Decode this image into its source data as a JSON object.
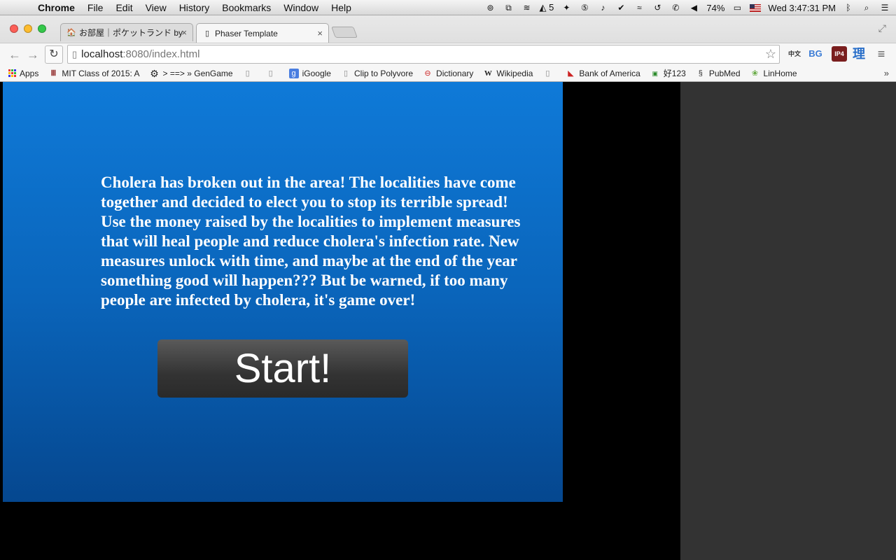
{
  "menubar": {
    "app_name": "Chrome",
    "items": [
      "File",
      "Edit",
      "View",
      "History",
      "Bookmarks",
      "Window",
      "Help"
    ],
    "status": {
      "adobe_count": "5",
      "battery": "74%",
      "clock": "Wed 3:47:31 PM"
    }
  },
  "browser": {
    "tabs": [
      {
        "title": "お部屋｜ポケットランド by",
        "active": false
      },
      {
        "title": "Phaser Template",
        "active": true
      }
    ],
    "url_host": "localhost",
    "url_rest": ":8080/index.html",
    "extensions": [
      "中文",
      "BG",
      "IP4",
      "理",
      "≡"
    ]
  },
  "bookmarks": [
    {
      "label": "Apps",
      "icon": "apps-grid-icon"
    },
    {
      "label": "MIT Class of 2015: A",
      "icon": "mit-icon"
    },
    {
      "label": "> ==> » GenGame",
      "icon": "gear-icon"
    },
    {
      "label": "",
      "icon": "page-icon"
    },
    {
      "label": "",
      "icon": "page-icon"
    },
    {
      "label": "iGoogle",
      "icon": "google-icon"
    },
    {
      "label": "Clip to Polyvore",
      "icon": "page-icon"
    },
    {
      "label": "Dictionary",
      "icon": "dictionary-icon"
    },
    {
      "label": "Wikipedia",
      "icon": "wikipedia-icon"
    },
    {
      "label": "",
      "icon": "page-icon"
    },
    {
      "label": "Bank of America",
      "icon": "bank-icon"
    },
    {
      "label": "好123",
      "icon": "hao123-icon"
    },
    {
      "label": "PubMed",
      "icon": "pubmed-icon"
    },
    {
      "label": "LinHome",
      "icon": "linhome-icon"
    }
  ],
  "game": {
    "intro_text": "Cholera has broken out in the area! The localities have come together and decided to elect you to stop its terrible spread! Use the money raised by the localities to implement measures that will heal people and reduce cholera's infection rate. New measures unlock with time, and maybe at the end of the year something good will happen??? But be warned, if too many people are infected by cholera, it's game over!",
    "start_label": "Start!"
  }
}
